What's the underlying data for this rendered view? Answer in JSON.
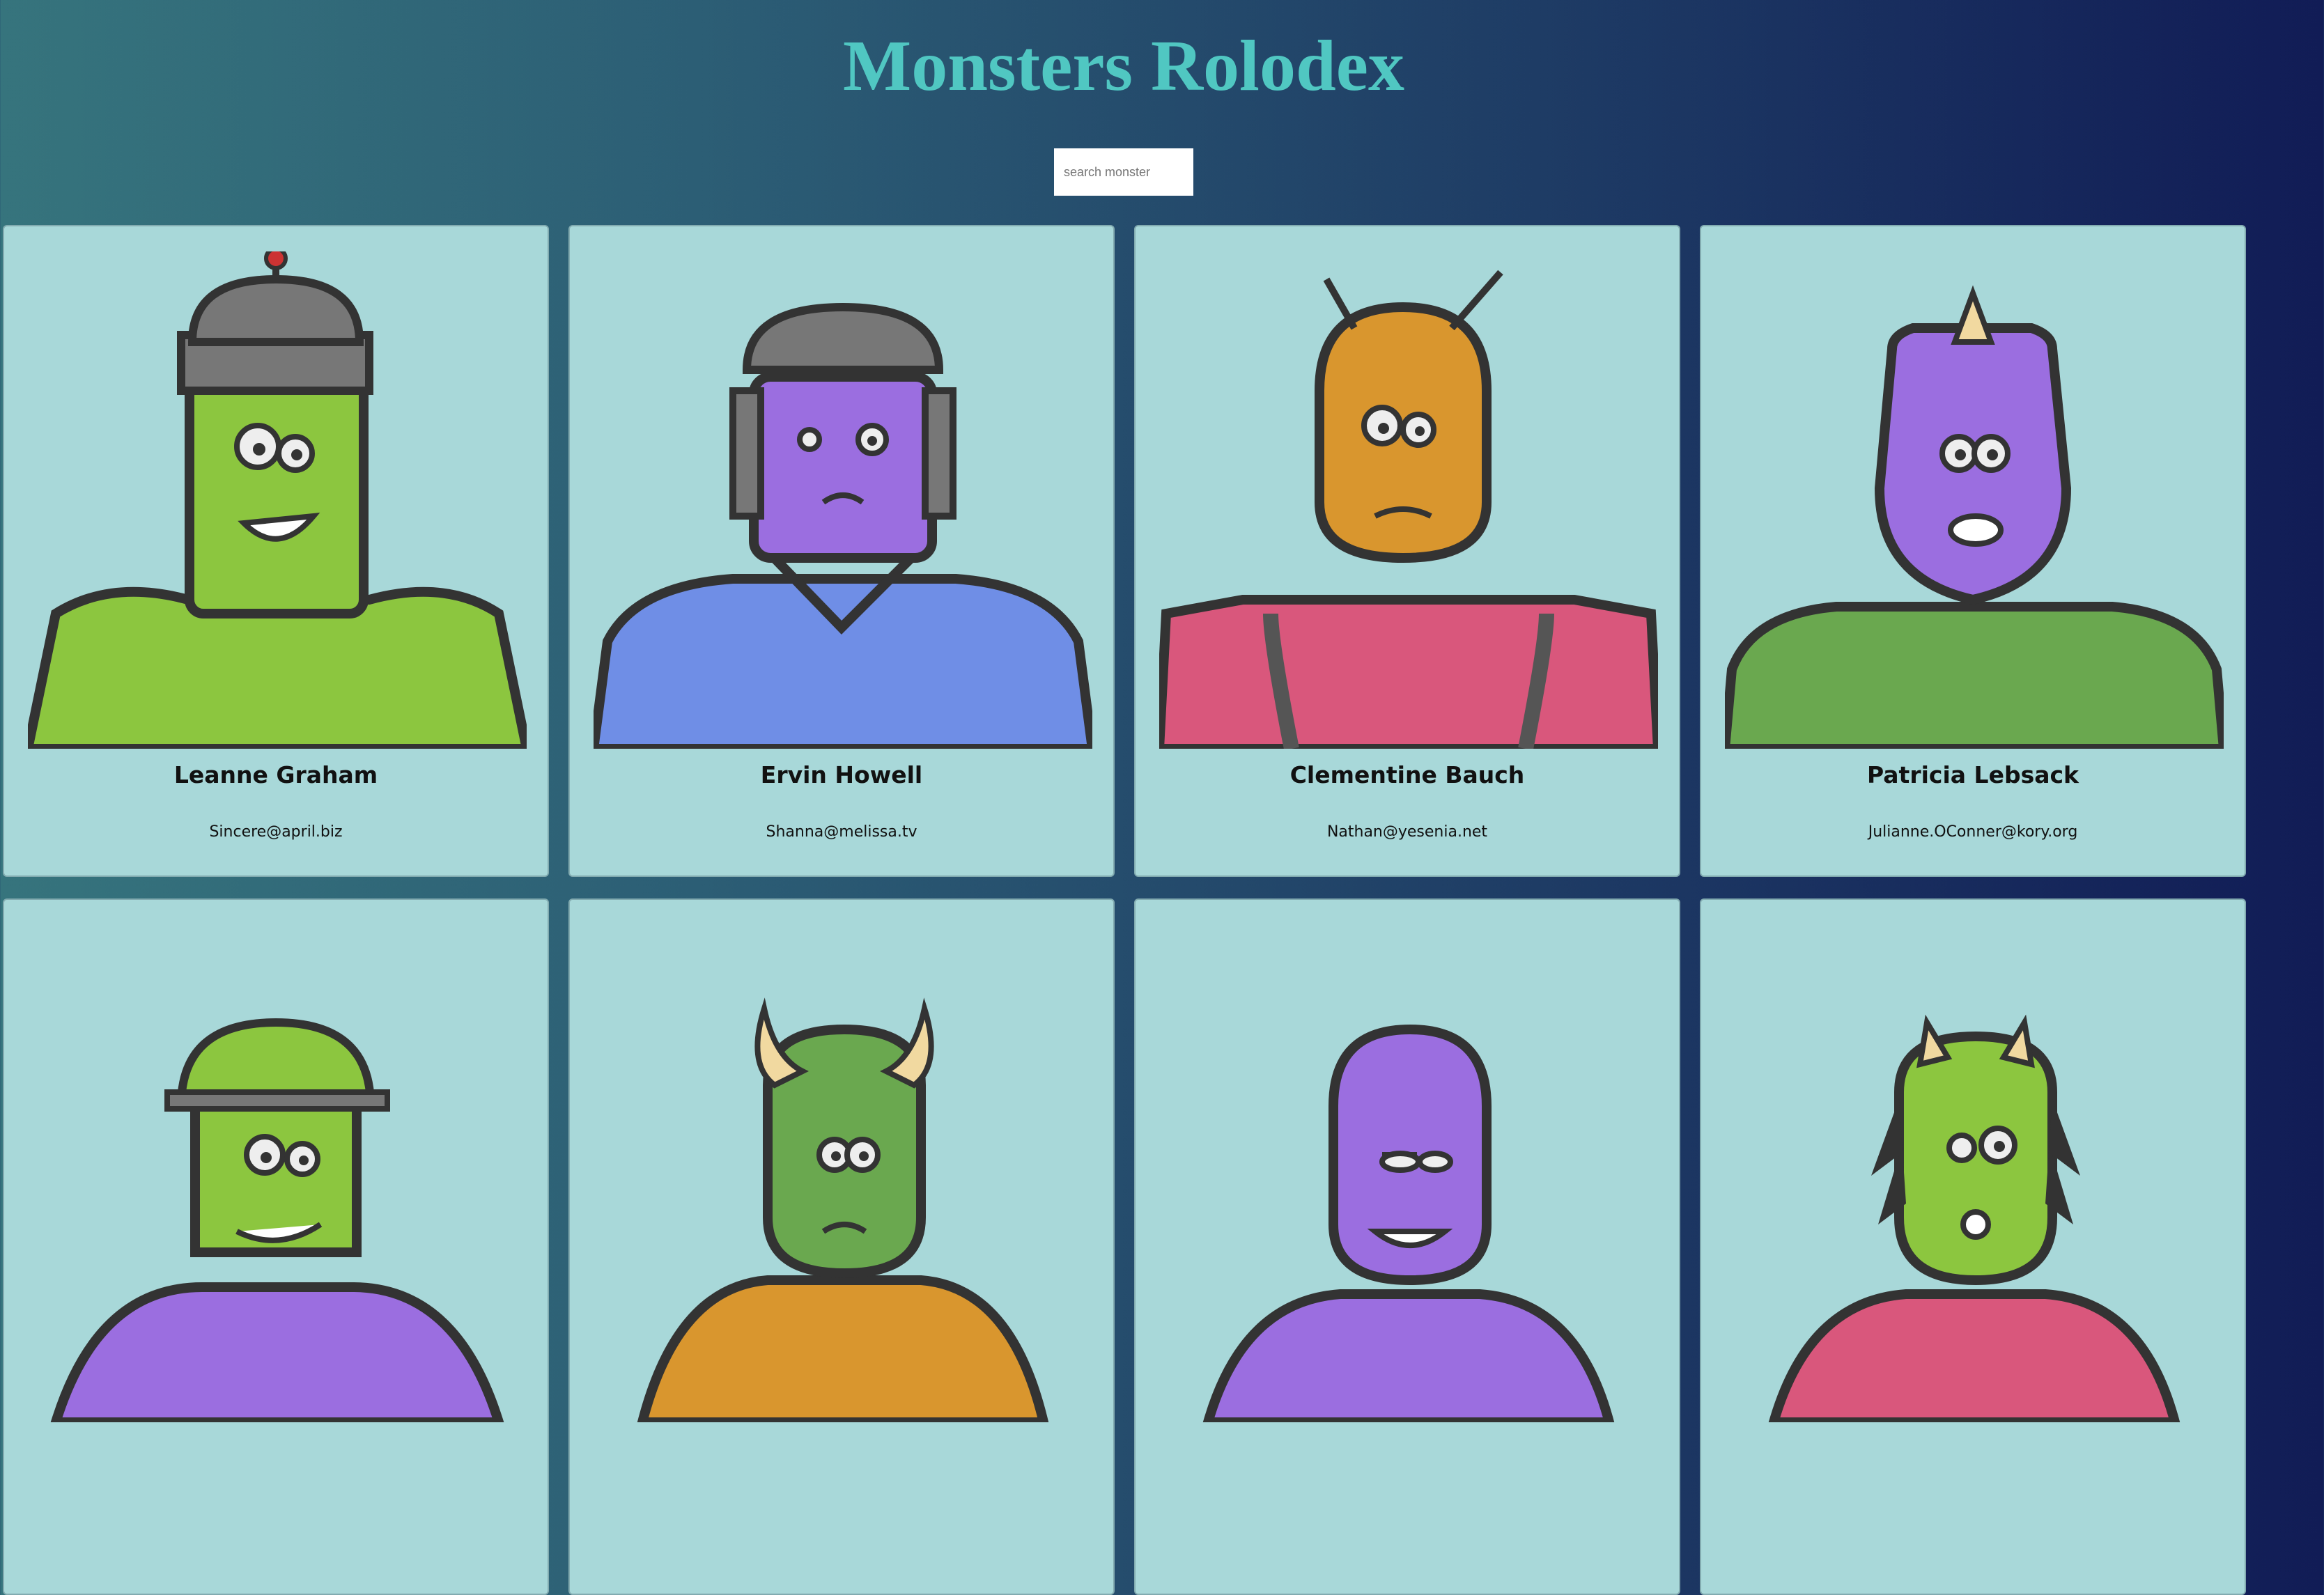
{
  "app": {
    "title": "Monsters Rolodex"
  },
  "search": {
    "placeholder": "search monster",
    "value": ""
  },
  "monsters": [
    {
      "name": "Leanne Graham",
      "email": "Sincere@april.biz",
      "skin": "#8cc63f",
      "body": "#8cc63f",
      "icon": "robot-helmet-monster"
    },
    {
      "name": "Ervin Howell",
      "email": "Shanna@melissa.tv",
      "skin": "#9b6ee0",
      "body": "#6f8ee6",
      "icon": "knight-helmet-monster"
    },
    {
      "name": "Clementine Bauch",
      "email": "Nathan@yesenia.net",
      "skin": "#d9962e",
      "body": "#d9577c",
      "icon": "antenna-monster"
    },
    {
      "name": "Patricia Lebsack",
      "email": "Julianne.OConner@kory.org",
      "skin": "#9b6ee0",
      "body": "#6aa84f",
      "icon": "horned-cyclops-monster"
    },
    {
      "name": "",
      "email": "",
      "skin": "#8cc63f",
      "body": "#9b6ee0",
      "icon": "robot-helmet-monster"
    },
    {
      "name": "",
      "email": "",
      "skin": "#6aa84f",
      "body": "#d9962e",
      "icon": "horned-monster"
    },
    {
      "name": "",
      "email": "",
      "skin": "#9b6ee0",
      "body": "#9b6ee0",
      "icon": "purple-alien-monster"
    },
    {
      "name": "",
      "email": "",
      "skin": "#8cc63f",
      "body": "#d9577c",
      "icon": "hairy-horned-monster"
    }
  ]
}
